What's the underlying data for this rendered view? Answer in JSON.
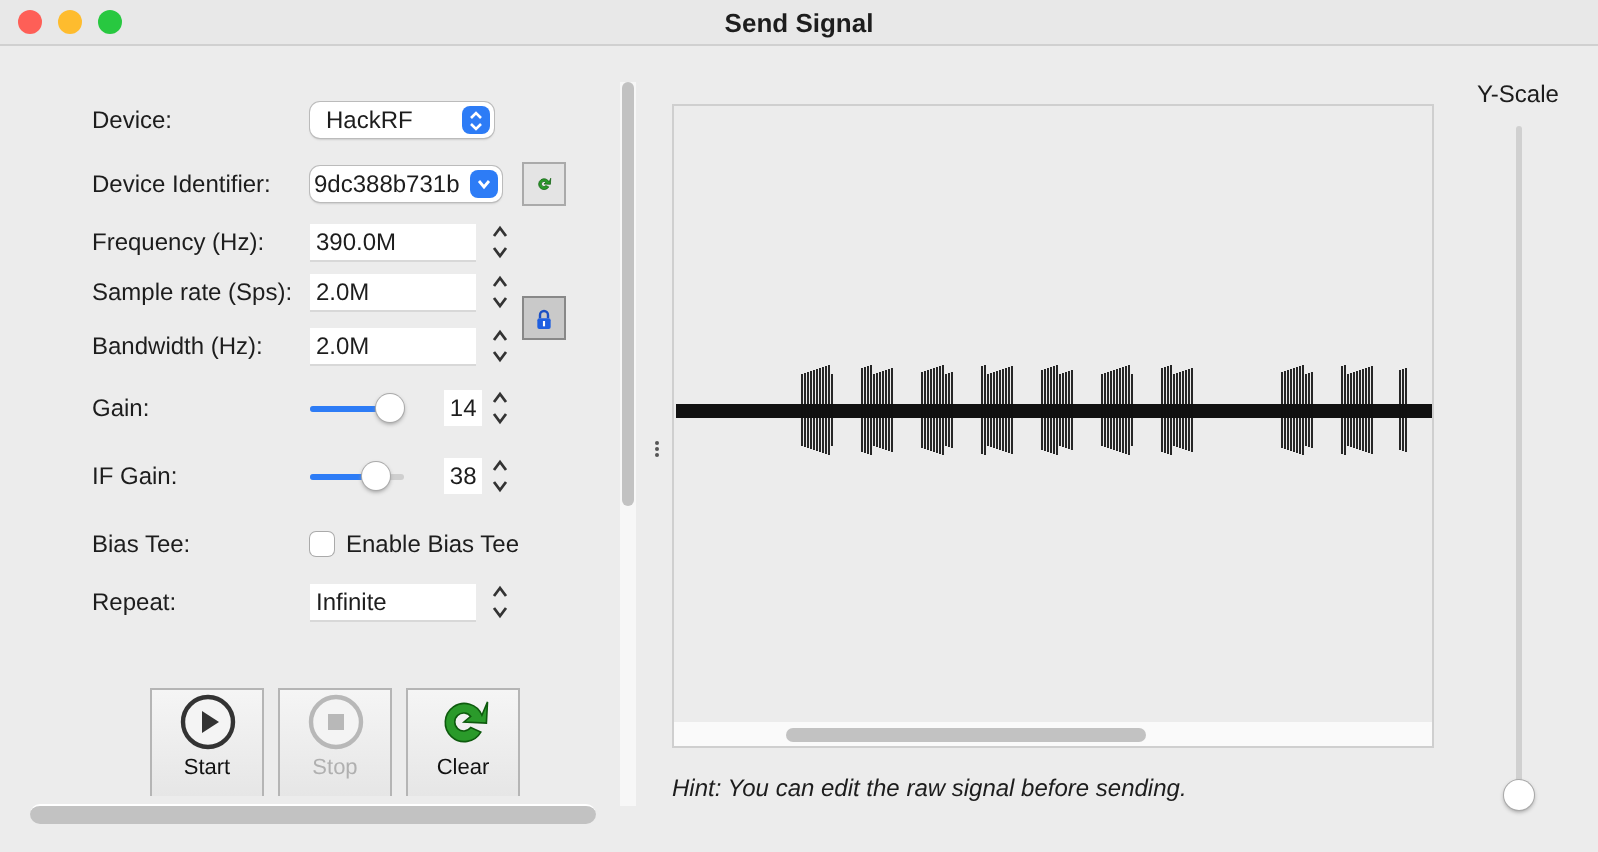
{
  "window": {
    "title": "Send Signal"
  },
  "fields": [
    {
      "kind": "select",
      "label": "Device:",
      "value": "HackRF"
    },
    {
      "kind": "combo",
      "label": "Device Identifier:",
      "value": "9dc388b731b"
    },
    {
      "kind": "spin",
      "label": "Frequency (Hz):",
      "value": "390.0M"
    },
    {
      "kind": "spin",
      "label": "Sample rate (Sps):",
      "value": "2.0M"
    },
    {
      "kind": "spin",
      "label": "Bandwidth (Hz):",
      "value": "2.0M"
    },
    {
      "kind": "slider",
      "label": "Gain:",
      "level": 0.85,
      "value": "14"
    },
    {
      "kind": "slider",
      "label": "IF Gain:",
      "level": 0.7,
      "value": "38"
    },
    {
      "kind": "checkbox",
      "label": "Bias Tee:",
      "text": "Enable Bias Tee",
      "checked": false
    },
    {
      "kind": "spin",
      "label": "Repeat:",
      "value": "Infinite"
    }
  ],
  "lock": {
    "on": true
  },
  "buttons": [
    {
      "kind": "start",
      "label": "Start",
      "disabled": false
    },
    {
      "kind": "stop",
      "label": "Stop",
      "disabled": true
    },
    {
      "kind": "clear",
      "label": "Clear",
      "disabled": false
    }
  ],
  "hint": "Hint: You can edit the raw signal before sending.",
  "y_scale": {
    "label": "Y-Scale",
    "level": 0
  }
}
